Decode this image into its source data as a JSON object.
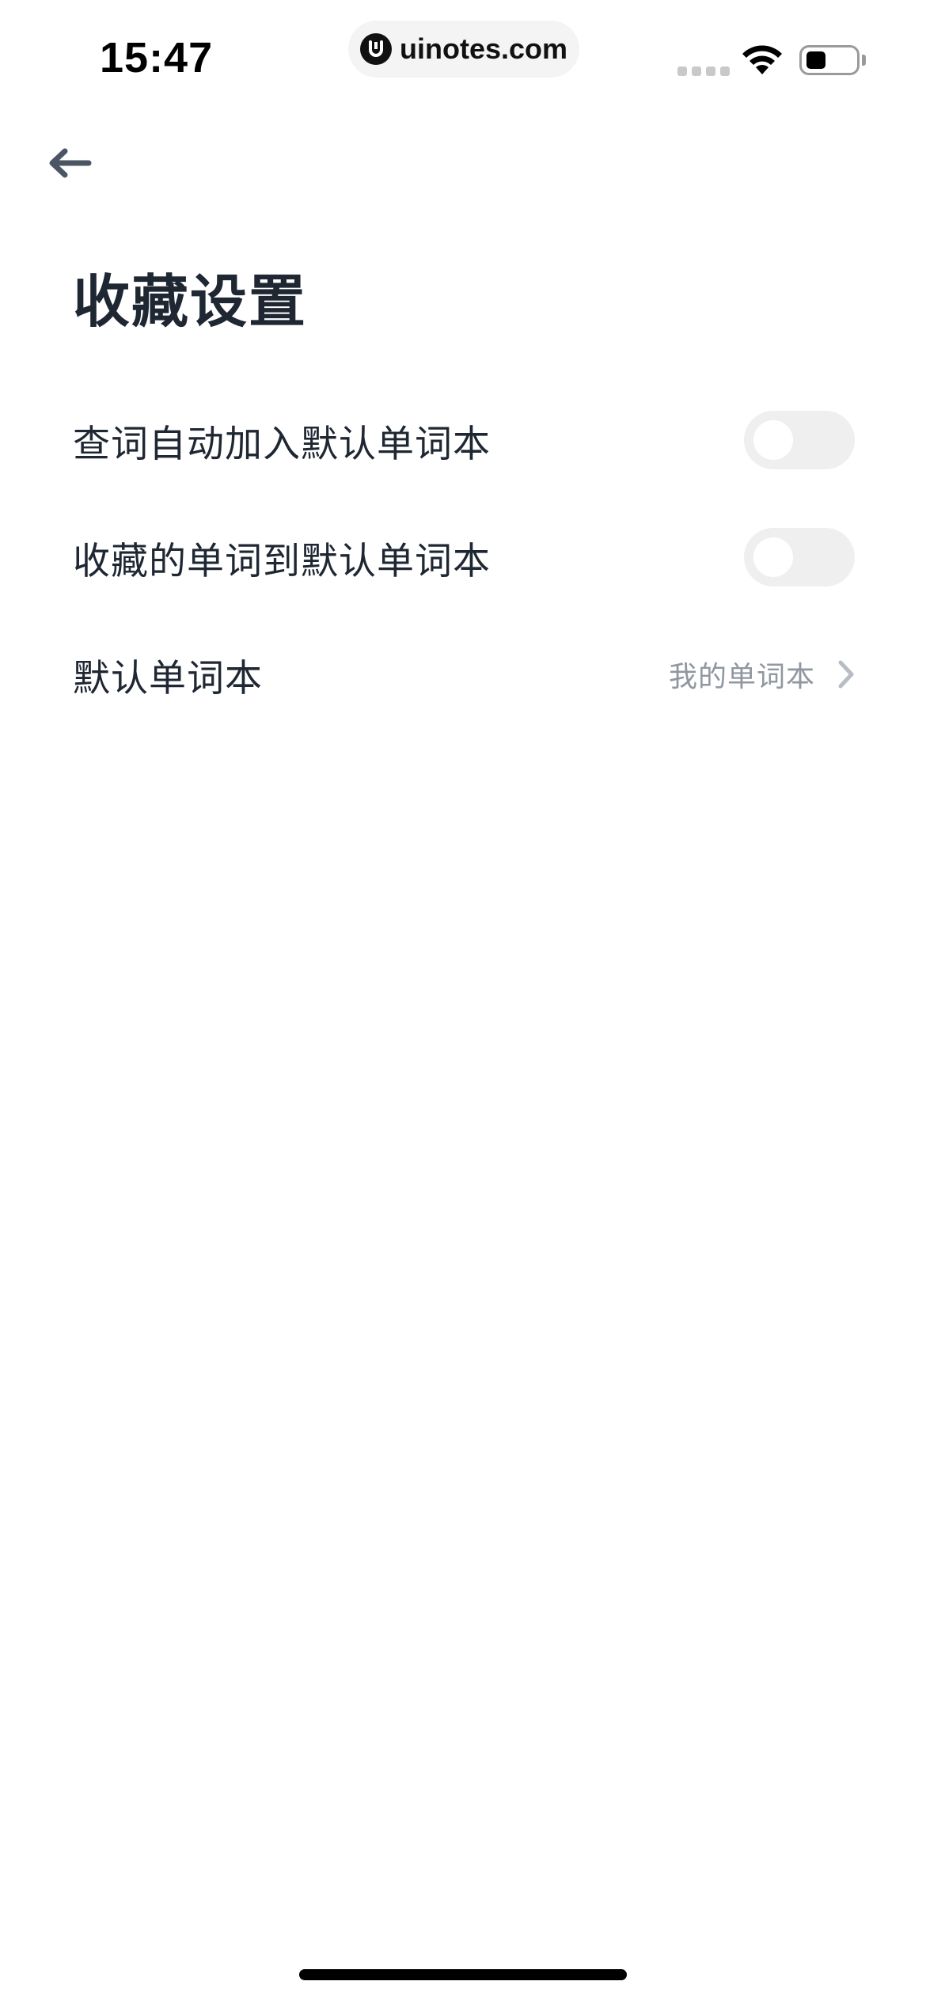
{
  "status_bar": {
    "time": "15:47",
    "url": "uinotes.com"
  },
  "header": {
    "back_icon": "arrow-left-icon",
    "title": "收藏设置"
  },
  "settings": {
    "items": [
      {
        "label": "查词自动加入默认单词本",
        "type": "toggle",
        "enabled": false
      },
      {
        "label": "收藏的单词到默认单词本",
        "type": "toggle",
        "enabled": false
      },
      {
        "label": "默认单词本",
        "type": "link",
        "value": "我的单词本"
      }
    ]
  },
  "colors": {
    "title": "#1f2733",
    "secondary_text": "#9097a0",
    "toggle_off_track": "#efefef",
    "background": "#ffffff"
  }
}
